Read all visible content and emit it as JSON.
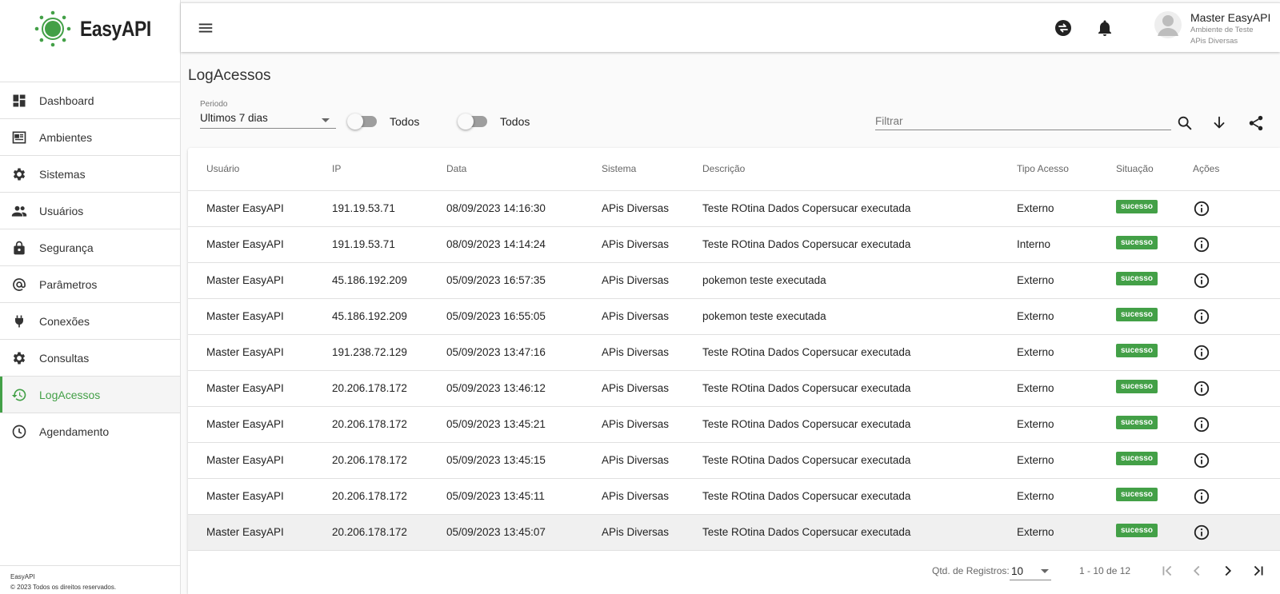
{
  "brand": {
    "name": "EasyAPI",
    "accent_color": "#43a047"
  },
  "sidebar": {
    "items": [
      {
        "label": "Dashboard",
        "icon": "dashboard-icon",
        "active": false
      },
      {
        "label": "Ambientes",
        "icon": "ambientes-icon",
        "active": false
      },
      {
        "label": "Sistemas",
        "icon": "gear-icon",
        "active": false
      },
      {
        "label": "Usuários",
        "icon": "people-icon",
        "active": false
      },
      {
        "label": "Segurança",
        "icon": "lock-icon",
        "active": false
      },
      {
        "label": "Parâmetros",
        "icon": "at-sign-icon",
        "active": false
      },
      {
        "label": "Conexões",
        "icon": "plug-icon",
        "active": false
      },
      {
        "label": "Consultas",
        "icon": "gear-icon",
        "active": false
      },
      {
        "label": "LogAcessos",
        "icon": "history-icon",
        "active": true
      },
      {
        "label": "Agendamento",
        "icon": "clock-icon",
        "active": false
      }
    ],
    "footer": {
      "line1": "EasyAPI",
      "line2": "© 2023 Todos os direitos reservados."
    }
  },
  "header": {
    "user": {
      "name": "Master EasyAPI",
      "environment": "Ambiente de Teste",
      "system": "APis Diversas"
    }
  },
  "page": {
    "title": "LogAcessos"
  },
  "filters": {
    "period": {
      "label": "Periodo",
      "value": "Ultimos 7 dias"
    },
    "toggle1": {
      "label": "Todos",
      "on": false
    },
    "toggle2": {
      "label": "Todos",
      "on": false
    },
    "search": {
      "placeholder": "Filtrar",
      "value": ""
    }
  },
  "table": {
    "headers": [
      "Usuário",
      "IP",
      "Data",
      "Sistema",
      "Descrição",
      "Tipo Acesso",
      "Situação",
      "Ações"
    ],
    "rows": [
      {
        "usuario": "Master EasyAPI",
        "ip": "191.19.53.71",
        "data": "08/09/2023 14:16:30",
        "sistema": "APis Diversas",
        "descricao": "Teste ROtina Dados Copersucar executada",
        "tipo": "Externo",
        "situacao": "sucesso"
      },
      {
        "usuario": "Master EasyAPI",
        "ip": "191.19.53.71",
        "data": "08/09/2023 14:14:24",
        "sistema": "APis Diversas",
        "descricao": "Teste ROtina Dados Copersucar executada",
        "tipo": "Interno",
        "situacao": "sucesso"
      },
      {
        "usuario": "Master EasyAPI",
        "ip": "45.186.192.209",
        "data": "05/09/2023 16:57:35",
        "sistema": "APis Diversas",
        "descricao": "pokemon teste executada",
        "tipo": "Externo",
        "situacao": "sucesso"
      },
      {
        "usuario": "Master EasyAPI",
        "ip": "45.186.192.209",
        "data": "05/09/2023 16:55:05",
        "sistema": "APis Diversas",
        "descricao": "pokemon teste executada",
        "tipo": "Externo",
        "situacao": "sucesso"
      },
      {
        "usuario": "Master EasyAPI",
        "ip": "191.238.72.129",
        "data": "05/09/2023 13:47:16",
        "sistema": "APis Diversas",
        "descricao": "Teste ROtina Dados Copersucar executada",
        "tipo": "Externo",
        "situacao": "sucesso"
      },
      {
        "usuario": "Master EasyAPI",
        "ip": "20.206.178.172",
        "data": "05/09/2023 13:46:12",
        "sistema": "APis Diversas",
        "descricao": "Teste ROtina Dados Copersucar executada",
        "tipo": "Externo",
        "situacao": "sucesso"
      },
      {
        "usuario": "Master EasyAPI",
        "ip": "20.206.178.172",
        "data": "05/09/2023 13:45:21",
        "sistema": "APis Diversas",
        "descricao": "Teste ROtina Dados Copersucar executada",
        "tipo": "Externo",
        "situacao": "sucesso"
      },
      {
        "usuario": "Master EasyAPI",
        "ip": "20.206.178.172",
        "data": "05/09/2023 13:45:15",
        "sistema": "APis Diversas",
        "descricao": "Teste ROtina Dados Copersucar executada",
        "tipo": "Externo",
        "situacao": "sucesso"
      },
      {
        "usuario": "Master EasyAPI",
        "ip": "20.206.178.172",
        "data": "05/09/2023 13:45:11",
        "sistema": "APis Diversas",
        "descricao": "Teste ROtina Dados Copersucar executada",
        "tipo": "Externo",
        "situacao": "sucesso"
      },
      {
        "usuario": "Master EasyAPI",
        "ip": "20.206.178.172",
        "data": "05/09/2023 13:45:07",
        "sistema": "APis Diversas",
        "descricao": "Teste ROtina Dados Copersucar executada",
        "tipo": "Externo",
        "situacao": "sucesso"
      }
    ]
  },
  "pagination": {
    "label": "Qtd. de Registros:",
    "page_size": "10",
    "range": "1 - 10 de 12"
  }
}
